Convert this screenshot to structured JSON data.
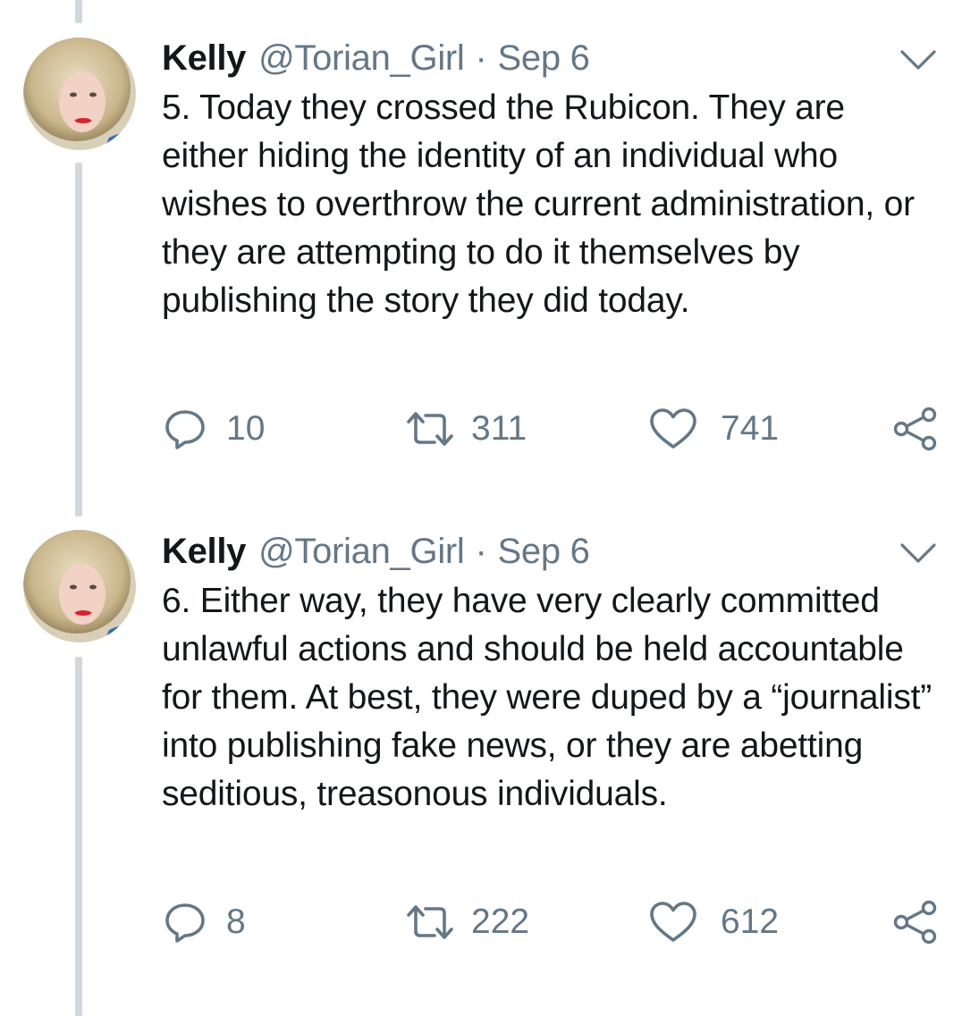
{
  "tweets": [
    {
      "display_name": "Kelly",
      "handle": "@Torian_Girl",
      "separator": "·",
      "date": "Sep 6",
      "text": "5. Today they crossed the Rubicon. They are either hiding the identity of an individual who wishes to overthrow the current administration, or they are attempting to do it themselves by publishing the story they did today.",
      "replies": "10",
      "retweets": "311",
      "likes": "741"
    },
    {
      "display_name": "Kelly",
      "handle": "@Torian_Girl",
      "separator": "·",
      "date": "Sep 6",
      "text": "6. Either way, they have very clearly committed unlawful actions and should be held accountable for them. At best, they were duped by a “journalist” into publishing fake news, or they are abetting seditious, treasonous individuals.",
      "replies": "8",
      "retweets": "222",
      "likes": "612"
    }
  ],
  "icons": {
    "reply": "reply-icon",
    "retweet": "retweet-icon",
    "like": "heart-icon",
    "share": "share-icon",
    "menu": "chevron-down-icon"
  },
  "colors": {
    "text": "#14171a",
    "secondary": "#657786",
    "thread_line": "#cfd9de"
  }
}
